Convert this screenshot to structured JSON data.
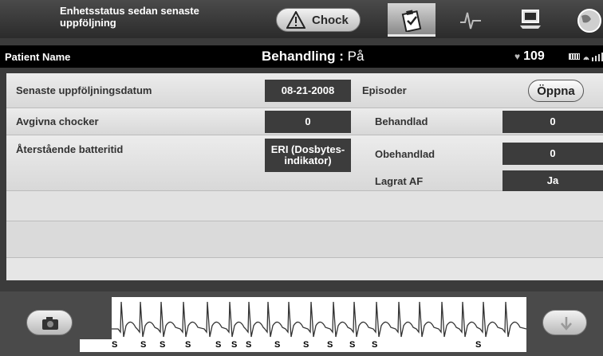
{
  "header": {
    "title": "Enhetsstatus sedan senaste uppföljning",
    "shock_button_label": "Chock"
  },
  "tabs": [
    {
      "icon": "clipboard-icon",
      "active": true
    },
    {
      "icon": "ecg-waveform-icon",
      "active": false
    },
    {
      "icon": "programmer-monitor-icon",
      "active": false
    },
    {
      "icon": "globe-icon",
      "active": false
    }
  ],
  "patient_bar": {
    "patient_name": "Patient Name",
    "therapy_label": "Behandling : ",
    "therapy_value": "På",
    "heart_rate": "109"
  },
  "status": {
    "last_followup_label": "Senaste uppföljningsdatum",
    "last_followup_value": "08-21-2008",
    "shocks_delivered_label": "Avgivna chocker",
    "shocks_delivered_value": "0",
    "battery_remaining_label": "Återstående batteritid",
    "battery_remaining_value": "ERI (Dosbytes-indikator)",
    "episodes_label": "Episoder",
    "open_button_label": "Öppna",
    "treated_label": "Behandlad",
    "treated_value": "0",
    "untreated_label": "Obehandlad",
    "untreated_value": "0",
    "stored_af_label": "Lagrat AF",
    "stored_af_value": "Ja"
  },
  "ecg": {
    "marker_label": "S",
    "markers": [
      "S",
      "S",
      "S",
      "S",
      "S",
      "S",
      "S",
      "S",
      "S",
      "S",
      "S",
      "S",
      "S"
    ]
  },
  "colors": {
    "value_box": "#3c3c3c",
    "panel": "#e6e6e6",
    "header_bg": "#2b2b2b"
  }
}
